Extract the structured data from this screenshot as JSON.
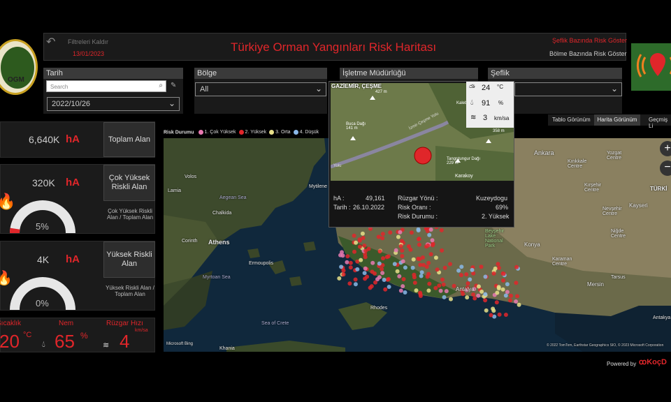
{
  "header": {
    "clear_filters": "Filtreleri Kaldır",
    "date": "13/01/2023",
    "title": "Türkiye Orman Yangınları Risk Haritası",
    "link_seflik": "Şeflik Bazında Risk Göster",
    "link_bolme": "Bölme Bazında Risk Göster"
  },
  "logo": {
    "text_top": "NEL MÜDÜRLÜĞÜ",
    "text_mid": "OGM",
    "text_year": "1839"
  },
  "filters": {
    "tarih_label": "Tarih",
    "search_placeholder": "Search",
    "tarih_value": "2022/10/26",
    "bolge_label": "Bölge",
    "bolge_value": "All",
    "isletme_label": "İşletme Müdürlüğü",
    "seflik_label": "Şeflik"
  },
  "kpis": {
    "toplam": {
      "value": "6,640K",
      "unit": "hA",
      "button": "Toplam Alan"
    },
    "cok_yuksek": {
      "value": "320K",
      "unit": "hA",
      "button": "Çok Yüksek Riskli Alan",
      "ratio_label": "Çok Yüksek Riskli Alan / Toplam Alan",
      "percent": "5%",
      "fraction": 0.05
    },
    "yuksek": {
      "value": "4K",
      "unit": "hA",
      "button": "Yüksek Riskli Alan",
      "ratio_label": "Yüksek Riskli Alan / Toplam Alan",
      "percent": "0%",
      "fraction": 0.0
    }
  },
  "weather": {
    "temp_label": "Sıcaklık",
    "temp_value": "20",
    "temp_unit": "°C",
    "hum_label": "Nem",
    "hum_value": "65",
    "hum_unit": "%",
    "wind_label": "Rüzgar Hızı",
    "wind_value": "4",
    "wind_unit": "km/sa"
  },
  "view_tabs": [
    "Tablo Görünüm",
    "Harita Görünüm",
    "Geçmiş Li"
  ],
  "legend": {
    "title": "Risk Durumu",
    "items": [
      {
        "label": "1. Çok Yüksek",
        "color": "#e87ab0"
      },
      {
        "label": "2. Yüksek",
        "color": "#e0262a"
      },
      {
        "label": "3. Orta",
        "color": "#e8e08a"
      },
      {
        "label": "4. Düşük",
        "color": "#8ab8e8"
      }
    ]
  },
  "map_labels": {
    "ankara": "Ankara",
    "yozgat": "Yozgat\nCentre",
    "kirikkale": "Kırıkkale\nCentre",
    "kirsehir": "Kırşehir\nCentre",
    "turkiye": "TÜRKİ",
    "kayseri": "Kayseri",
    "nevsehir": "Nevşehir\nCentre",
    "nigde": "Niğde\nCentre",
    "konya": "Konya",
    "karaman": "Karaman\nCentre",
    "mersin": "Mersin",
    "tarsus": "Tarsus",
    "antakya": "Antakya",
    "antalya": "Antalya",
    "rhodes": "Rhodes",
    "athens": "Athens",
    "corinth": "Corinth",
    "volos": "Volos",
    "aegean": "Aegean Sea",
    "myrtoan": "Myrtoan Sea",
    "crete_sea": "Sea of Crete",
    "ermoupolis": "Ermoupolis",
    "mytilene": "Mytilene",
    "chalkida": "Chalkida",
    "lamia": "Lamia",
    "beysehir": "Beyşehir\nLake\nNational\nPark",
    "kharia": "Khania",
    "attribution": "© 2022 TomTom, Earthstar Geographics SIO, © 2023 Microsoft Corporation",
    "bing": "Microsoft Bing"
  },
  "popup": {
    "place": "GAZİEMİR, ÇEŞME",
    "temp": "24",
    "temp_unit": "°C",
    "hum": "91",
    "hum_unit": "%",
    "wind": "3",
    "wind_unit": "km/sa",
    "ha_label": "hA :",
    "ha_value": "49,161",
    "tarih_label": "Tarih :",
    "tarih_value": "26.10.2022",
    "ruzgar_label": "Rüzgar Yönü :",
    "ruzgar_value": "Kuzeydogu",
    "oran_label": "Risk Oranı :",
    "oran_value": "69%",
    "durum_label": "Risk Durumu :",
    "durum_value": "2. Yüksek",
    "map_labels": [
      "Buca Dağı\n141 m",
      "Kaleb...",
      "Tangrıtungur Dağı\n229 m",
      "Karakoy",
      "358 m",
      "427 m",
      "İzmir-Çeşme Yolu",
      "Yolu"
    ]
  },
  "footer": {
    "powered": "Powered by",
    "brand": "KoçD"
  }
}
